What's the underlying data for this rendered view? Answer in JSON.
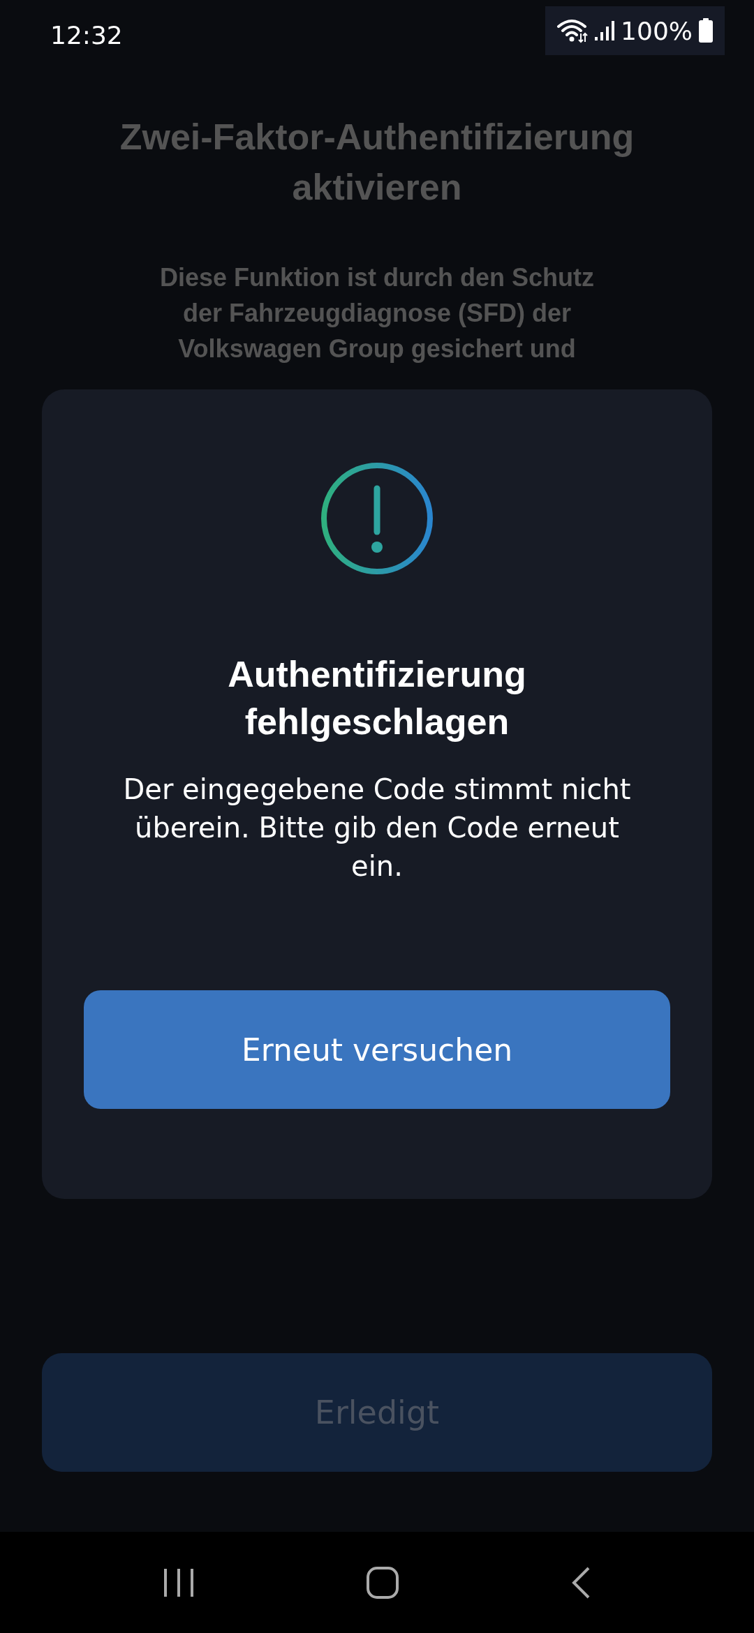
{
  "status_bar": {
    "time": "12:32",
    "battery": "100%"
  },
  "screen": {
    "title": "Zwei-Faktor-Authentifizierung aktivieren",
    "description": "Diese Funktion ist durch den Schutz der Fahrzeugdiagnose (SFD) der Volkswagen Group gesichert und",
    "done_button": {
      "label": "Erledigt",
      "disabled": true
    }
  },
  "dialog": {
    "title": "Authentifizierung fehlgeschlagen",
    "message": "Der eingegebene Code stimmt nicht überein. Bitte gib den Code erneut ein.",
    "button": "Erneut versuchen"
  }
}
